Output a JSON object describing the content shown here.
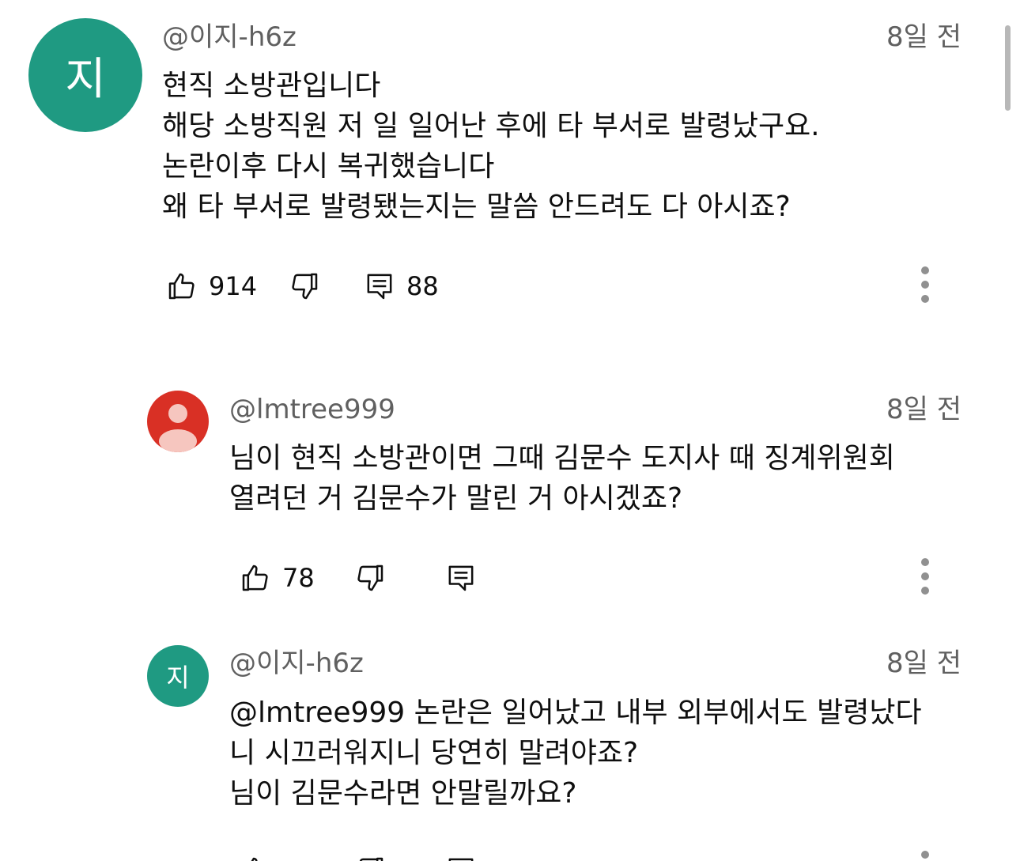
{
  "comments": [
    {
      "handle": "@이지-h6z",
      "avatar_letter": "지",
      "avatar_color": "#1f9a82",
      "time": "8일 전",
      "lines": [
        "현직 소방관입니다",
        "해당 소방직원 저 일 일어난 후에 타 부서로 발령났구요.",
        "논란이후 다시 복귀했습니다",
        "왜 타 부서로 발령됐는지는 말씀 안드려도 다 아시죠?"
      ],
      "likes": "914",
      "replies": "88"
    },
    {
      "handle": "@lmtree999",
      "avatar_color": "#d93025",
      "time": "8일 전",
      "lines": [
        "님이 현직 소방관이면 그때 김문수 도지사 때 징계위원회",
        "열려던 거 김문수가 말린 거 아시겠죠?"
      ],
      "likes": "78"
    },
    {
      "handle": "@이지-h6z",
      "avatar_letter": "지",
      "avatar_color": "#1f9a82",
      "time": "8일 전",
      "lines": [
        "@lmtree999 논란은 일어났고 내부 외부에서도 발령났다",
        "니 시끄러워지니 당연히 말려야죠?",
        "님이 김문수라면 안말릴까요?"
      ]
    }
  ],
  "icons": {
    "like": "thumbs-up-icon",
    "dislike": "thumbs-down-icon",
    "reply": "reply-comment-icon",
    "more": "more-vertical-icon"
  },
  "colors": {
    "secondary_text": "#606060",
    "primary_text": "#0f0f0f",
    "icon": "#0f0f0f"
  }
}
